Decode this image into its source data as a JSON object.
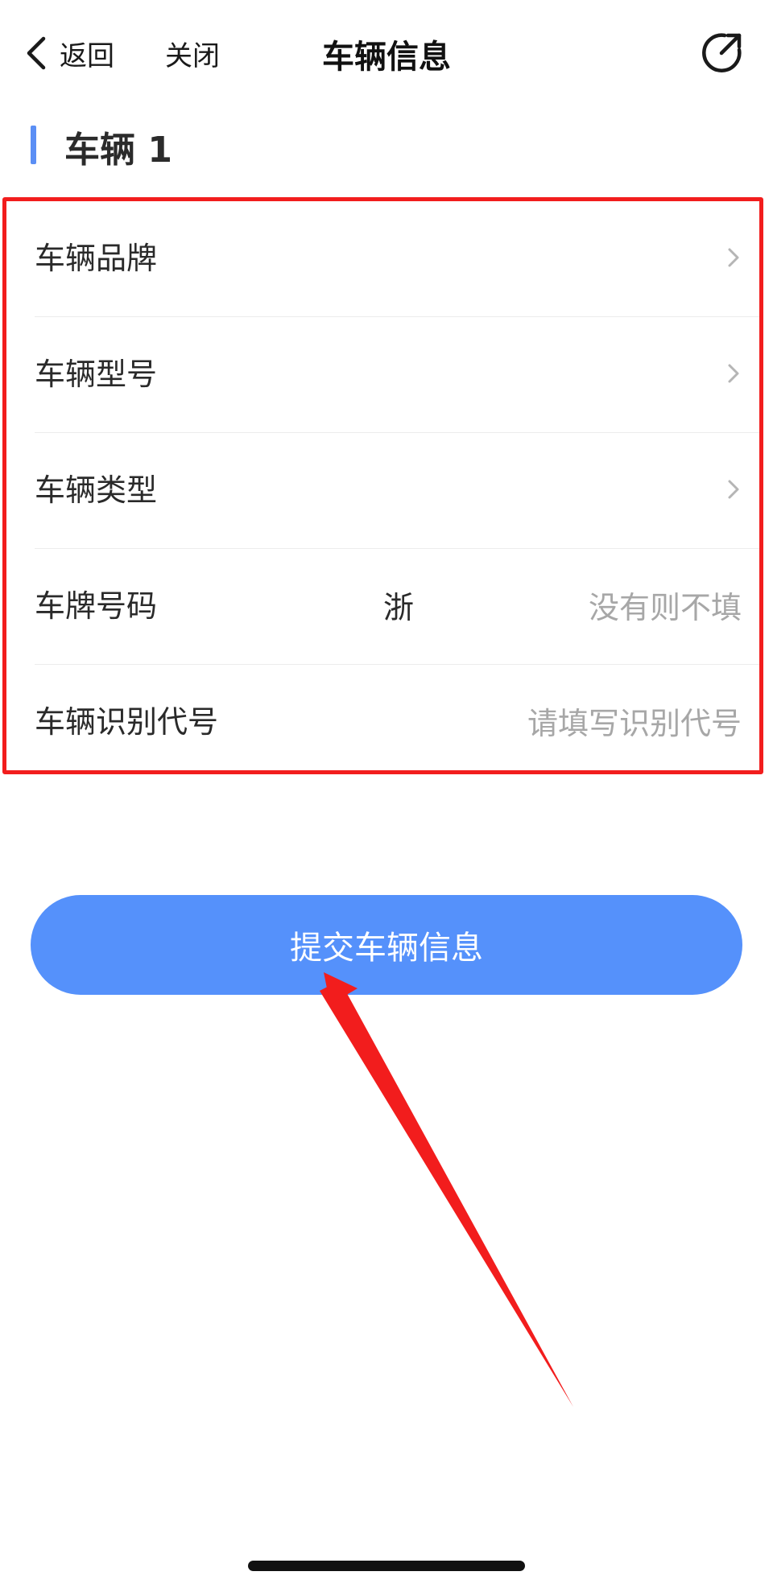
{
  "nav": {
    "back_label": "返回",
    "close_label": "关闭",
    "title": "车辆信息"
  },
  "section": {
    "title": "车辆 1"
  },
  "form": {
    "brand": {
      "label": "车辆品牌"
    },
    "model": {
      "label": "车辆型号"
    },
    "type": {
      "label": "车辆类型"
    },
    "plate": {
      "label": "车牌号码",
      "prefix": "浙",
      "placeholder": "没有则不填"
    },
    "vin": {
      "label": "车辆识别代号",
      "placeholder": "请填写识别代号"
    }
  },
  "submit_label": "提交车辆信息",
  "colors": {
    "accent": "#5591fb",
    "section_bar": "#5b8ff5",
    "annotation": "#f21d1d",
    "placeholder": "#a7a7a7"
  },
  "icons": {
    "back": "chevron-left-icon",
    "refresh": "refresh-icon",
    "row_chevron": "chevron-right-icon"
  }
}
